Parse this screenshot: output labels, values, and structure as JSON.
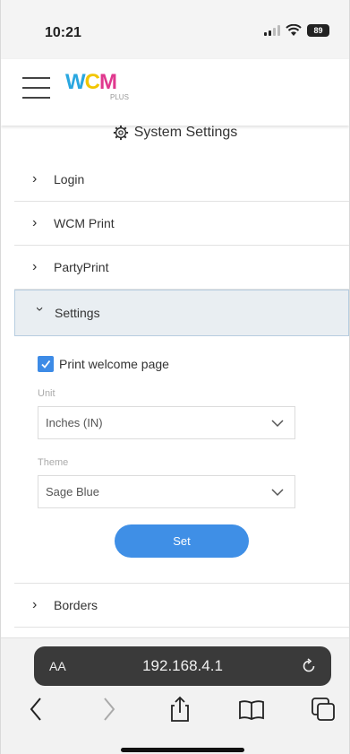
{
  "status_bar": {
    "time": "10:21",
    "battery": "89"
  },
  "app": {
    "logo": {
      "w": "W",
      "c": "C",
      "m": "M",
      "plus": "PLUS"
    }
  },
  "page": {
    "title": "System Settings"
  },
  "accordion": {
    "items": [
      {
        "label": "Login"
      },
      {
        "label": "WCM Print"
      },
      {
        "label": "PartyPrint"
      },
      {
        "label": "Settings"
      },
      {
        "label": "Borders"
      }
    ]
  },
  "settings": {
    "print_welcome_label": "Print welcome page",
    "print_welcome_checked": true,
    "unit_label": "Unit",
    "unit_value": "Inches (IN)",
    "theme_label": "Theme",
    "theme_value": "Sage Blue",
    "set_button": "Set"
  },
  "browser": {
    "aa": "AA",
    "url": "192.168.4.1"
  },
  "colors": {
    "accent": "#3f8fe6",
    "open_header_bg": "#e9eef2",
    "url_bar_bg": "#3a3a3a"
  }
}
